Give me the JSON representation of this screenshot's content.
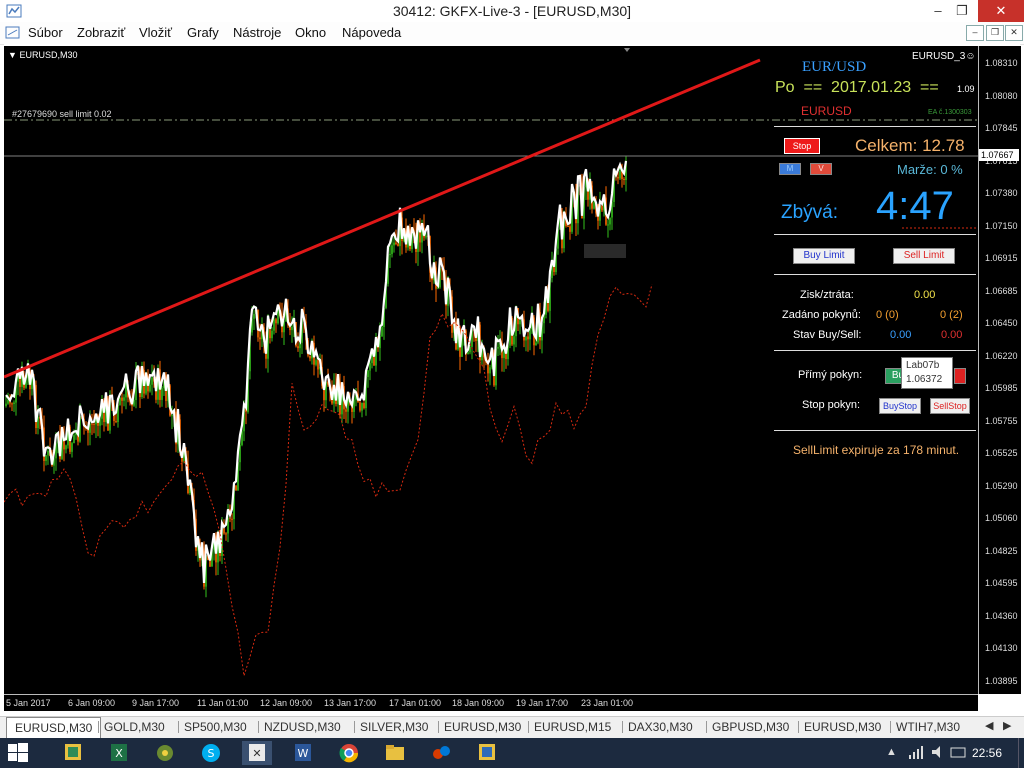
{
  "window": {
    "title": "30412: GKFX-Live-3 - [EURUSD,M30]",
    "minimize": "‒",
    "maximize": "❐",
    "close": "✕"
  },
  "menu": [
    "Súbor",
    "Zobraziť",
    "Vložiť",
    "Grafy",
    "Nástroje",
    "Okno",
    "Nápoveda"
  ],
  "chart": {
    "symbol_label": "EURUSD,M30",
    "order_line_label": "#27679690 sell limit 0.02",
    "current_price": "1.07667",
    "price_ticks": [
      "1.08310",
      "1.08080",
      "1.07845",
      "1.07615",
      "1.07380",
      "1.07150",
      "1.06915",
      "1.06685",
      "1.06450",
      "1.06220",
      "1.05985",
      "1.05755",
      "1.05525",
      "1.05290",
      "1.05060",
      "1.04825",
      "1.04595",
      "1.04360",
      "1.04130",
      "1.03895"
    ],
    "time_ticks": [
      "5 Jan 2017",
      "6 Jan 09:00",
      "9 Jan 17:00",
      "11 Jan 01:00",
      "12 Jan 09:00",
      "13 Jan 17:00",
      "17 Jan 01:00",
      "18 Jan 09:00",
      "19 Jan 17:00",
      "23 Jan 01:00"
    ]
  },
  "panel": {
    "ea_name": "EURUSD_3☺",
    "pair": "EUR/USD",
    "day": "Po",
    "eq1": "==",
    "date": "2017.01.23",
    "eq2": "==",
    "version": "1.09",
    "symbol": "EURUSD",
    "ea_number": "EA č.1300303",
    "stop_button": "Stop",
    "total_label": "Celkem: 12.78",
    "m_button": "M",
    "v_button": "V",
    "margin_label": "Marže:  0 %",
    "remaining_label": "Zbývá:",
    "timer": "4:47",
    "buy_limit": "Buy Limit",
    "sell_limit": "Sell Limit",
    "profit_label": "Zisk/ztráta:",
    "profit_value": "0.00",
    "orders_label": "Zadáno pokynů:",
    "orders_buy": "0 (0)",
    "orders_sell": "0 (2)",
    "status_label": "Stav Buy/Sell:",
    "status_buy": "0.00",
    "status_sell": "0.00",
    "direct_label": "Přímý pokyn:",
    "direct_buy": "Bu",
    "stop_order_label": "Stop pokyn:",
    "buy_stop": "BuyStop",
    "sell_stop": "SellStop",
    "expiry": "SellLimit  expiruje za 178 minut.",
    "tooltip_name": "Lab07b",
    "tooltip_value": "1.06372"
  },
  "tabs": [
    "EURUSD,M30",
    "GOLD,M30",
    "SP500,M30",
    "NZDUSD,M30",
    "SILVER,M30",
    "EURUSD,M30",
    "EURUSD,M15",
    "DAX30,M30",
    "GBPUSD,M30",
    "EURUSD,M30",
    "WTIH7,M30"
  ],
  "taskbar": {
    "clock": "22:56"
  },
  "colors": {
    "trendline": "#e01818",
    "bull": "#35c21b",
    "bear": "#ff6a00",
    "close_line": "#ffffff",
    "pair_color": "#3aa0ff",
    "total_color": "#f5b26b",
    "timer_color": "#2aa3ff"
  }
}
